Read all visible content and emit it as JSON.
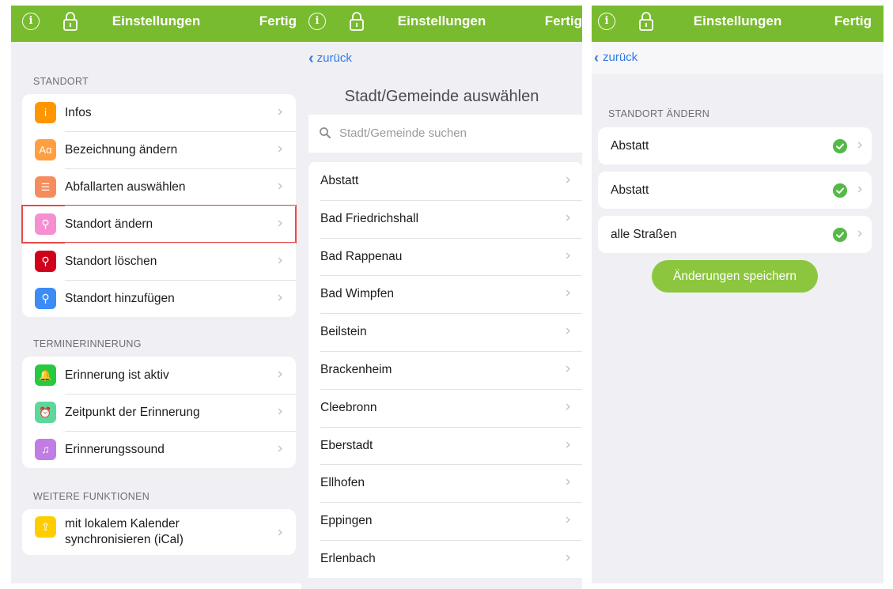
{
  "colors": {
    "topbar": "#79bb2e",
    "link": "#2f7ae5",
    "save_button": "#8cc63f",
    "highlight": "#e84a4a",
    "check": "#55b948"
  },
  "topbar": {
    "title": "Einstellungen",
    "done": "Fertig",
    "info_icon": "info-icon",
    "lock_icon": "lock-icon"
  },
  "panel1": {
    "sections": [
      {
        "title": "STANDORT",
        "items": [
          {
            "label": "Infos",
            "icon": "info-icon",
            "color": "#ff9500",
            "glyph": "i"
          },
          {
            "label": "Bezeichnung ändern",
            "icon": "text-icon",
            "color": "#ff9f40",
            "glyph": "Aα"
          },
          {
            "label": "Abfallarten auswählen",
            "icon": "checklist-icon",
            "color": "#f58c5c",
            "glyph": "☰"
          },
          {
            "label": "Standort ändern",
            "icon": "location-edit-icon",
            "color": "#f58fcf",
            "glyph": "⚲"
          },
          {
            "label": "Standort löschen",
            "icon": "location-delete-icon",
            "color": "#d0021b",
            "glyph": "⚲"
          },
          {
            "label": "Standort hinzufügen",
            "icon": "location-add-icon",
            "color": "#3d8cf5",
            "glyph": "⚲"
          }
        ]
      },
      {
        "title": "TERMINERINNERUNG",
        "items": [
          {
            "label": "Erinnerung ist aktiv",
            "icon": "bell-icon",
            "color": "#27c93f",
            "glyph": "🔔"
          },
          {
            "label": "Zeitpunkt der Erinnerung",
            "icon": "alarm-icon",
            "color": "#5dd89b",
            "glyph": "⏰"
          },
          {
            "label": "Erinnerungssound",
            "icon": "music-note-icon",
            "color": "#c17de6",
            "glyph": "♫"
          }
        ]
      },
      {
        "title": "WEITERE FUNKTIONEN",
        "items": [
          {
            "label_line1": "mit lokalem Kalender",
            "label_line2": "synchronisieren (iCal)",
            "icon": "calendar-export-icon",
            "color": "#ffcc00",
            "glyph": "⇪"
          }
        ]
      }
    ]
  },
  "panel2": {
    "back": "zurück",
    "heading": "Stadt/Gemeinde auswählen",
    "search_placeholder": "Stadt/Gemeinde suchen",
    "cities": [
      "Abstatt",
      "Bad Friedrichshall",
      "Bad Rappenau",
      "Bad Wimpfen",
      "Beilstein",
      "Brackenheim",
      "Cleebronn",
      "Eberstadt",
      "Ellhofen",
      "Eppingen",
      "Erlenbach"
    ]
  },
  "panel3": {
    "back": "zurück",
    "section": "STANDORT ÄNDERN",
    "selections": [
      "Abstatt",
      "Abstatt",
      "alle Straßen"
    ],
    "save": "Änderungen speichern"
  }
}
